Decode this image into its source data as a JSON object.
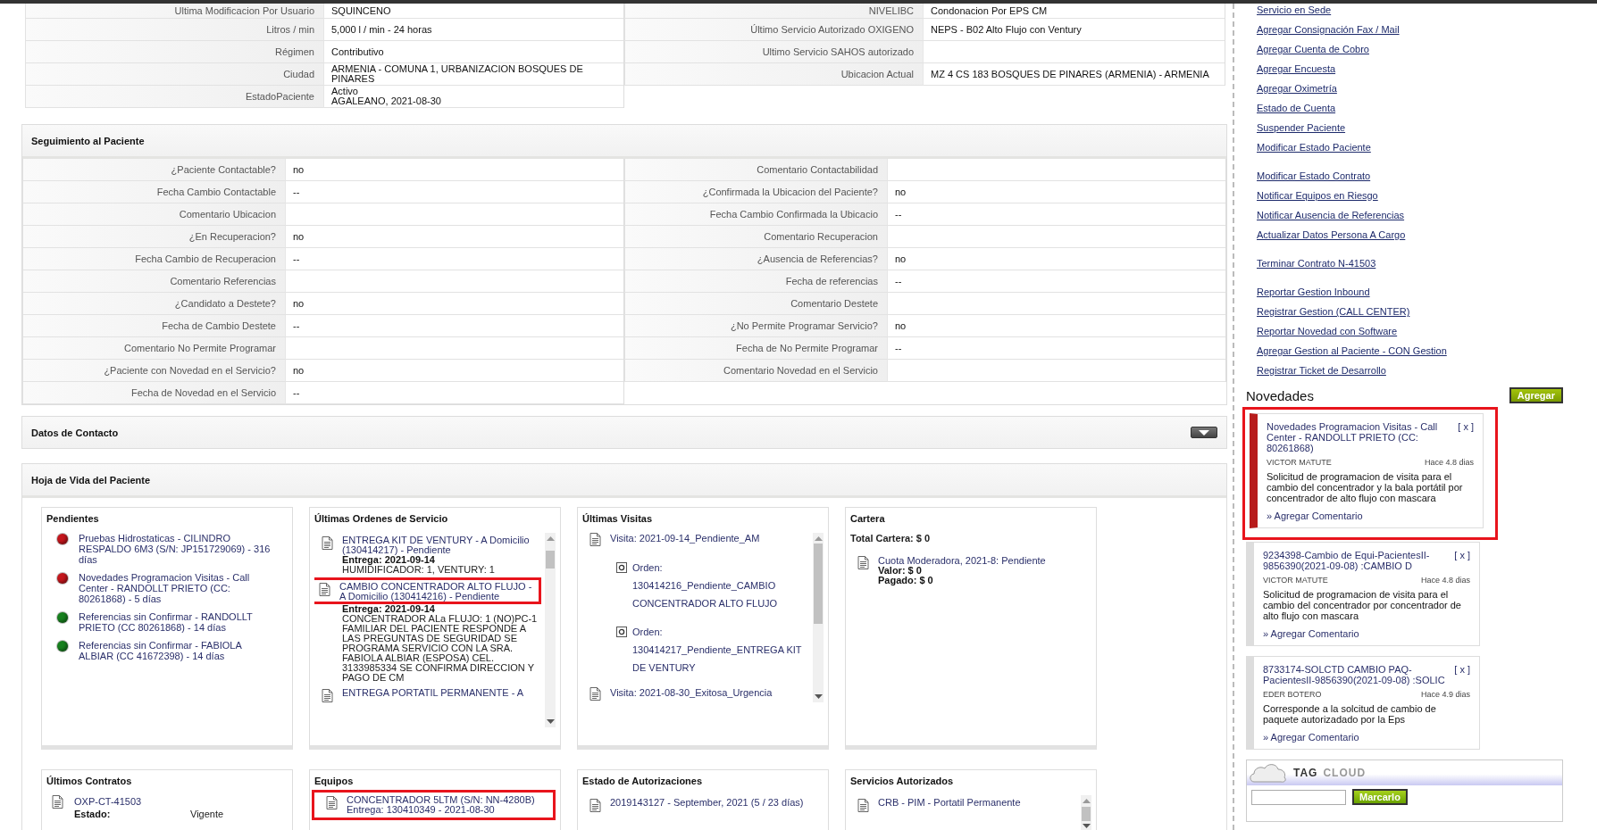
{
  "info_table": {
    "left_rows": [
      {
        "label": "Ultima Modificacion Por Usuario",
        "value": "SQUINCENO"
      },
      {
        "label": "Litros / min",
        "value": "5,000 l / min - 24 horas"
      },
      {
        "label": "Régimen",
        "value": "Contributivo"
      },
      {
        "label": "Ciudad",
        "value": "ARMENIA - COMUNA 1, URBANIZACION BOSQUES DE PINARES"
      },
      {
        "label": "EstadoPaciente",
        "value": "Activo",
        "detail": "AGALEANO, 2021-08-30"
      }
    ],
    "right_rows": [
      {
        "label": "NIVELIBC",
        "value": "Condonacion Por EPS CM"
      },
      {
        "label": "Último Servicio Autorizado OXIGENO",
        "value": "NEPS - B02 Alto Flujo con Ventury"
      },
      {
        "label": "Ultimo Servicio SAHOS autorizado"
      },
      {
        "label": "Ubicacion Actual",
        "value": "MZ 4 CS 183 BOSQUES DE PINARES (ARMENIA) - ARMENIA"
      }
    ]
  },
  "seguimiento": {
    "title": "Seguimiento al Paciente",
    "left_rows": [
      {
        "label": "¿Paciente Contactable?",
        "value": "no"
      },
      {
        "label": "Fecha Cambio Contactable",
        "value": "--"
      },
      {
        "label": "Comentario Ubicacion"
      },
      {
        "label": "¿En Recuperacion?",
        "value": "no"
      },
      {
        "label": "Fecha Cambio de Recuperacion",
        "value": "--"
      },
      {
        "label": "Comentario Referencias"
      },
      {
        "label": "¿Candidato a Destete?",
        "value": "no"
      },
      {
        "label": "Fecha de Cambio Destete",
        "value": "--"
      },
      {
        "label": "Comentario No Permite Programar"
      },
      {
        "label": "¿Paciente con Novedad en el Servicio?",
        "value": "no"
      },
      {
        "label": "Fecha de Novedad en el Servicio",
        "value": "--"
      }
    ],
    "right_rows": [
      {
        "label": "Comentario Contactabilidad"
      },
      {
        "label": "¿Confirmada la Ubicacion del Paciente?",
        "value": "no"
      },
      {
        "label": "Fecha Cambio Confirmada la Ubicacio",
        "value": "--"
      },
      {
        "label": "Comentario Recuperacion"
      },
      {
        "label": "¿Ausencia de Referencias?",
        "value": "no"
      },
      {
        "label": "Fecha de referencias",
        "value": "--"
      },
      {
        "label": "Comentario Destete"
      },
      {
        "label": "¿No Permite Programar Servicio?",
        "value": "no"
      },
      {
        "label": "Fecha de No Permite Programar",
        "value": "--"
      },
      {
        "label": "Comentario Novedad en el Servicio"
      }
    ]
  },
  "datos_contacto": {
    "title": "Datos de Contacto"
  },
  "hoja_de_vida": {
    "title": "Hoja de Vida del Paciente",
    "pendientes": {
      "title": "Pendientes",
      "items": [
        {
          "text": "Pruebas Hidrostaticas - CILINDRO RESPALDO 6M3 (S/N: JP151729069) - 316 días",
          "color": "#c4161c"
        },
        {
          "text": "Novedades Programacion Visitas - Call Center - RANDOLLT PRIETO (CC: 80261868) - 5 días",
          "color": "#c4161c"
        },
        {
          "text": "Referencias sin Confirmar - RANDOLLT PRIETO (CC 80261868) - 14 días",
          "color": "#17801e"
        },
        {
          "text": "Referencias sin Confirmar - FABIOLA ALBIAR (CC 41672398) - 14 días",
          "color": "#17801e"
        }
      ]
    },
    "ordenes": {
      "title": "Últimas Ordenes de Servicio",
      "items": [
        {
          "title": "ENTREGA KIT DE VENTURY - A Domicilio (130414217) - Pendiente",
          "entrega": "Entrega: 2021-09-14",
          "details": "HUMIDIFICADOR: 1, VENTURY: 1",
          "highlighted": false
        },
        {
          "title": "CAMBIO CONCENTRADOR ALTO FLUJO - A Domicilio (130414216) - Pendiente",
          "entrega": "Entrega: 2021-09-14",
          "details": "CONCENTRADOR ALa FLUJO: 1 (NO)PC-1 FAMILIAR DEL PACIENTE RESPONDE A LAS PREGUNTAS DE SEGURIDAD SE PROGRAMA SERVICIO CON LA SRA. FABIOLA ALBIAR (ESPOSA) CEL. 3133985334 SE CONFIRMA DIRECCION Y PAGO DE CM",
          "highlighted": true
        },
        {
          "title": "ENTREGA PORTATIL PERMANENTE - A",
          "highlighted": false
        }
      ]
    },
    "visitas": {
      "title": "Últimas Visitas",
      "items": [
        {
          "title": "Visita: 2021-09-14_Pendiente_AM",
          "orders": [
            {
              "label": "Orden:",
              "text": "130414216_Pendiente_CAMBIO CONCENTRADOR ALTO FLUJO"
            },
            {
              "label": "Orden:",
              "text": "130414217_Pendiente_ENTREGA KIT DE VENTURY"
            }
          ]
        },
        {
          "title": "Visita: 2021-08-30_Exitosa_Urgencia"
        }
      ]
    },
    "cartera": {
      "title": "Cartera",
      "total": "Total Cartera: $ 0",
      "items": [
        {
          "title": "Cuota Moderadora, 2021-8: Pendiente",
          "valor": "Valor: $ 0",
          "pagado": "Pagado: $ 0"
        }
      ]
    },
    "contratos": {
      "title": "Últimos Contratos",
      "items": [
        {
          "code": "OXP-CT-41503",
          "label": "Estado:",
          "value": "Vigente"
        }
      ]
    },
    "equipos": {
      "title": "Equipos",
      "items": [
        {
          "title": "CONCENTRADOR 5LTM (S/N: NN-4280B)",
          "entrega": "Entrega: 130410349 - 2021-08-30",
          "highlighted": true
        }
      ]
    },
    "autorizaciones": {
      "title": "Estado de Autorizaciones",
      "items": [
        "2019143127 - September, 2021 (5 / 23 días)"
      ]
    },
    "servicios": {
      "title": "Servicios Autorizados",
      "items": [
        "CRB - PIM - Portatil Permanente"
      ]
    }
  },
  "sidebar": {
    "link_groups": [
      [
        "Servicio en Sede",
        "Agregar Consignación Fax / Mail",
        "Agregar Cuenta de Cobro",
        "Agregar Encuesta",
        "Agregar Oximetría",
        "Estado de Cuenta",
        "Suspender Paciente",
        "Modificar Estado Paciente"
      ],
      [
        "Modificar Estado Contrato",
        "Notificar Equipos en Riesgo",
        "Notificar Ausencia de Referencias",
        "Actualizar Datos Persona A Cargo"
      ],
      [
        "Terminar Contrato N-41503"
      ],
      [
        "Reportar Gestion Inbound",
        "Registrar Gestion (CALL CENTER)",
        "Reportar Novedad con Software",
        "Agregar Gestion al Paciente - CON Gestion",
        "Registrar Ticket de Desarrollo"
      ]
    ],
    "novedades": {
      "title": "Novedades",
      "add_button": "Agregar",
      "items": [
        {
          "title": "Novedades Programacion Visitas - Call Center - RANDOLLT PRIETO (CC: 80261868)",
          "close": "[ x ]",
          "author": "VICTOR MATUTE",
          "time": "Hace 4.8 dias",
          "body": "Solicitud de programacion de visita para el cambio del concentrador y la bala portátil por concentrador de alto flujo con mascara",
          "comment_link": "» Agregar Comentario",
          "color": "#b71c1c",
          "highlighted": true
        },
        {
          "title": "9234398-Cambio de Equi-PacientesII-9856390(2021-09-08) :CAMBIO D",
          "close": "[ x ]",
          "author": "VICTOR MATUTE",
          "time": "Hace 4.8 dias",
          "body": "Solicitud de programacion de visita para el cambio del concentrador por concentrador de alto flujo con mascara",
          "comment_link": "» Agregar Comentario",
          "color": "#dddddd",
          "highlighted": false
        },
        {
          "title": "8733174-SOLCTD CAMBIO PAQ-PacientesII-9856390(2021-09-08) :SOLIC",
          "close": "[ x ]",
          "author": "EDER BOTERO",
          "time": "Hace 4.9 dias",
          "body": "Corresponde a la solcitud de cambio de paquete autorizadado por la Eps",
          "comment_link": "» Agregar Comentario",
          "color": "#dddddd",
          "highlighted": false
        }
      ]
    },
    "tag_cloud": {
      "title_first": "TAG",
      "title_second": "CLOUD",
      "button": "Marcarlo"
    }
  }
}
